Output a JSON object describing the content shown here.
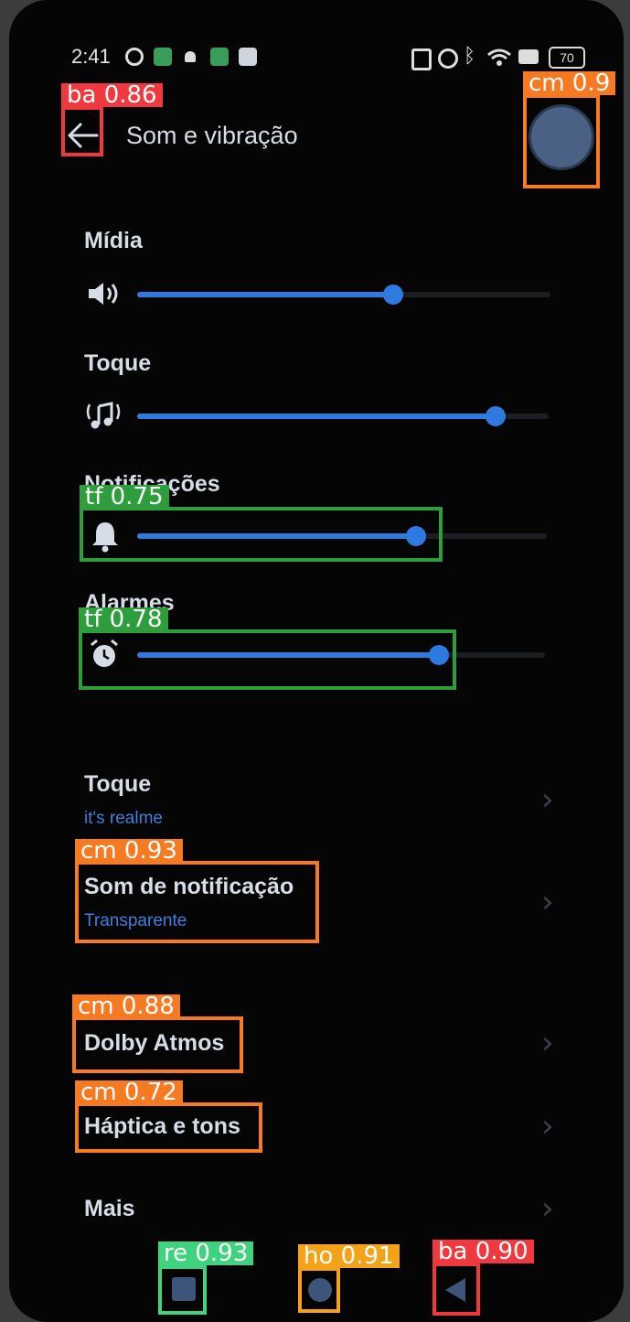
{
  "status_bar": {
    "time": "2:41",
    "battery": "70"
  },
  "header": {
    "title": "Som e vibração"
  },
  "volume": {
    "media": {
      "label": "Mídia",
      "level": 0.62,
      "icon": "speaker-icon"
    },
    "ring": {
      "label": "Toque",
      "level": 0.87,
      "icon": "music-note-icon"
    },
    "notifications": {
      "label": "Notificações",
      "level": 0.68,
      "icon": "bell-icon"
    },
    "alarms": {
      "label": "Alarmes",
      "level": 0.74,
      "icon": "alarm-clock-icon"
    }
  },
  "settings": [
    {
      "title": "Toque",
      "subtitle": "it's realme"
    },
    {
      "title": "Som de notificação",
      "subtitle": "Transparente"
    },
    {
      "title": "Dolby Atmos",
      "subtitle": ""
    },
    {
      "title": "Háptica e tons",
      "subtitle": ""
    },
    {
      "title": "Mais",
      "subtitle": ""
    }
  ],
  "detections": {
    "back": "ba 0.86",
    "floating": "cm 0.9",
    "notif_slider": "tf 0.75",
    "alarm_slider": "tf 0.78",
    "notif_sound": "cm 0.93",
    "dolby": "cm 0.88",
    "haptic": "cm 0.72",
    "recents": "re 0.93",
    "home": "ho 0.91",
    "nav_back": "ba 0.90"
  },
  "colors": {
    "accent": "#2f7ae0",
    "background": "#050505",
    "text": "#d6dde7",
    "det_red": "#f0393f",
    "det_orange": "#f57a22",
    "det_green": "#2e9e3c",
    "det_mint": "#3fd27f",
    "det_yellow": "#f4a318"
  }
}
